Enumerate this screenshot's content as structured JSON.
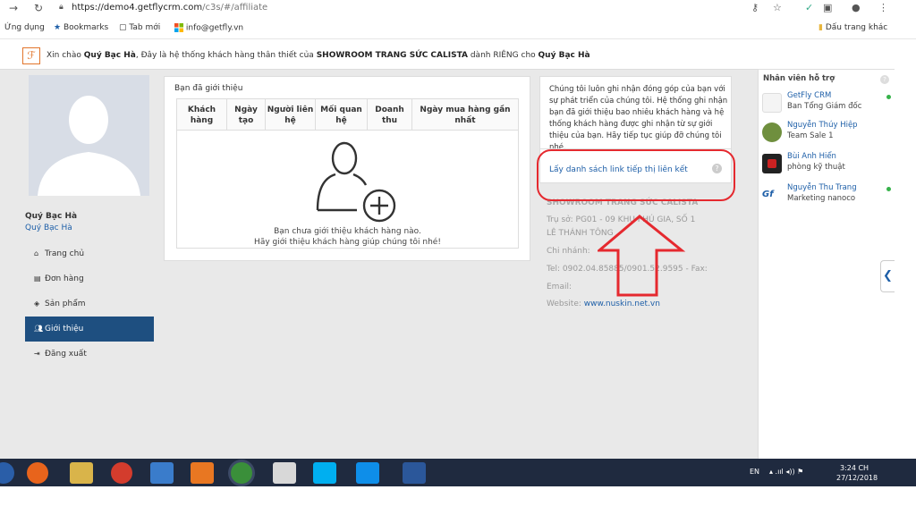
{
  "browser": {
    "url_host": "https://demo4.getflycrm.com",
    "url_path": "/c3s/#/affiliate"
  },
  "bookmarks": {
    "apps": "Ứng dụng",
    "bookmarks": "Bookmarks",
    "new_tab": "Tab mới",
    "email": "info@getfly.vn",
    "other": "Dấu trang khác"
  },
  "greeting": {
    "prefix": "Xin chào ",
    "name": "Quý Bạc Hà",
    "middle": ", Đây là hệ thống khách hàng thân thiết của ",
    "company": "SHOWROOM TRANG SỨC CALISTA",
    "suffix": " dành RIÊNG cho ",
    "name2": "Quý Bạc Hà"
  },
  "user": {
    "name": "Quý Bạc Hà",
    "sub": "Quý Bạc Hà"
  },
  "sidebar": {
    "items": [
      {
        "label": "Trang chủ",
        "icon": "home-icon"
      },
      {
        "label": "Đơn hàng",
        "icon": "document-icon"
      },
      {
        "label": "Sản phẩm",
        "icon": "cube-icon"
      },
      {
        "label": "Giới thiệu",
        "icon": "users-icon"
      },
      {
        "label": "Đăng xuất",
        "icon": "logout-icon"
      }
    ]
  },
  "referrals": {
    "title": "Bạn đã giới thiệu",
    "columns": [
      "Khách hàng",
      "Ngày tạo",
      "Người liên hệ",
      "Mối quan hệ",
      "Doanh thu",
      "Ngày mua hàng gần nhất"
    ],
    "empty_line1": "Bạn chưa giới thiệu khách hàng nào.",
    "empty_line2": "Hãy giới thiệu khách hàng giúp chúng tôi nhé!"
  },
  "info": {
    "text": "Chúng tôi luôn ghi nhận đóng góp của bạn với sự phát triển của chúng tôi. Hệ thống ghi nhận bạn đã giới thiệu bao nhiêu khách hàng và hệ thống khách hàng được ghi nhận từ sự giới thiệu của bạn. Hãy tiếp tục giúp đỡ chúng tôi nhé.",
    "link": "Lấy danh sách link tiếp thị liên kết"
  },
  "company": {
    "name": "SHOWROOM TRANG SỨC CALISTA",
    "address1": "Trụ sở: PG01 - 09 KHU PHÚ GIA, SỐ 1",
    "address2": "LÊ THÁNH TÔNG",
    "branch": "Chi nhánh:",
    "tel": "Tel: 0902.04.85885/0901.52.9595 - Fax:",
    "email": "Email:",
    "website_label": "Website: ",
    "website": "www.nuskin.net.vn"
  },
  "support": {
    "title": "Nhân viên hỗ trợ",
    "staff": [
      {
        "name": "GetFly CRM",
        "role": "Ban Tổng Giám đốc"
      },
      {
        "name": "Nguyễn Thúy Hiệp",
        "role": "Team Sale 1"
      },
      {
        "name": "Bùi Anh Hiển",
        "role": "phòng kỹ thuật"
      },
      {
        "name": "Nguyễn Thu Trang",
        "role": "Marketing nanoco"
      }
    ]
  },
  "taskbar": {
    "lang": "EN",
    "time": "3:24 CH",
    "date": "27/12/2018"
  },
  "colors": {
    "accent": "#1e4f80",
    "link": "#1e5fa8",
    "highlight": "#e5292f"
  }
}
